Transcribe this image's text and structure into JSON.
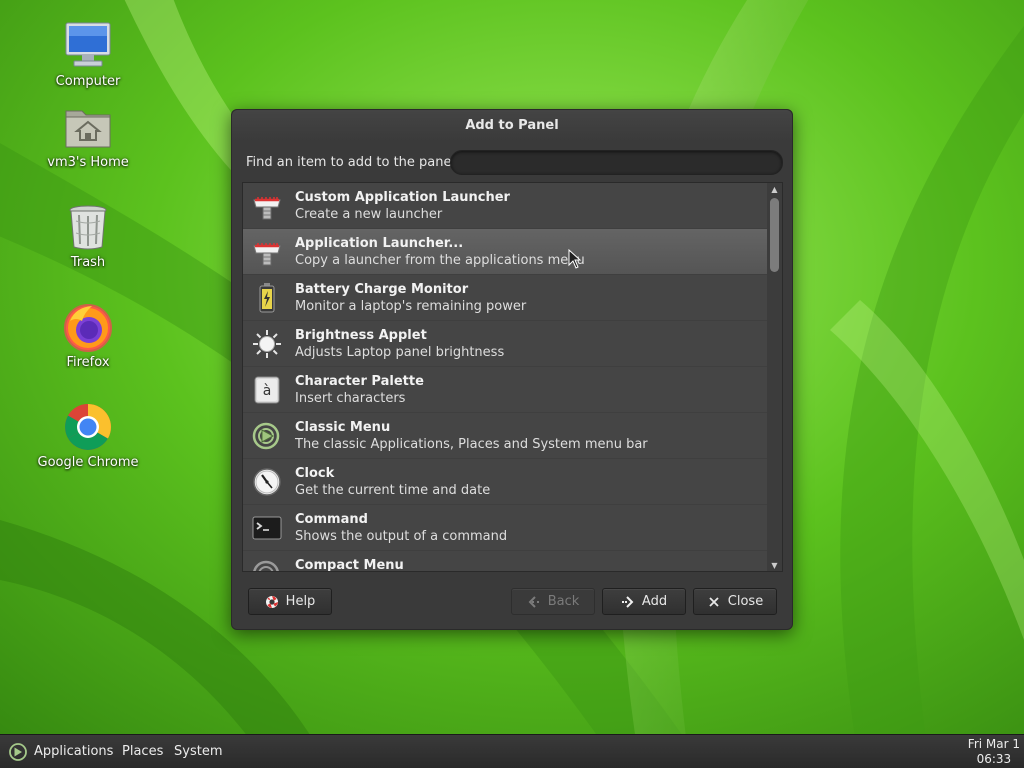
{
  "desktop": {
    "icons": [
      {
        "label": "Computer"
      },
      {
        "label": "vm3's Home"
      },
      {
        "label": "Trash"
      },
      {
        "label": "Firefox"
      },
      {
        "label": "Google Chrome"
      }
    ]
  },
  "dialog": {
    "title": "Add to Panel",
    "search_label": "Find an item to add to the panel:",
    "search_value": "",
    "items": [
      {
        "title": "Custom Application Launcher",
        "desc": "Create a new launcher",
        "icon": "launcher-icon"
      },
      {
        "title": "Application Launcher...",
        "desc": "Copy a launcher from the applications menu",
        "icon": "launcher-icon"
      },
      {
        "title": "Battery Charge Monitor",
        "desc": "Monitor a laptop's remaining power",
        "icon": "battery-icon"
      },
      {
        "title": "Brightness Applet",
        "desc": "Adjusts Laptop panel brightness",
        "icon": "brightness-icon"
      },
      {
        "title": "Character Palette",
        "desc": "Insert characters",
        "icon": "character-palette-icon"
      },
      {
        "title": "Classic Menu",
        "desc": "The classic Applications, Places and System menu bar",
        "icon": "classic-menu-icon"
      },
      {
        "title": "Clock",
        "desc": "Get the current time and date",
        "icon": "clock-icon"
      },
      {
        "title": "Command",
        "desc": "Shows the output of a command",
        "icon": "terminal-icon"
      },
      {
        "title": "Compact Menu",
        "desc": "",
        "icon": "compact-menu-icon"
      }
    ],
    "selected_index": 1,
    "buttons": {
      "help": "Help",
      "back": "Back",
      "add": "Add",
      "close": "Close"
    }
  },
  "panel": {
    "menus": [
      "Applications",
      "Places",
      "System"
    ],
    "clock_date": "Fri Mar 1",
    "clock_time": "06:33"
  },
  "colors": {
    "dialog_bg": "#3a3a3a",
    "list_bg": "#454545",
    "selected_row": "#5c5c5c",
    "panel_bg": "#2f2f2f",
    "wallpaper_green": "#5cc21e"
  }
}
